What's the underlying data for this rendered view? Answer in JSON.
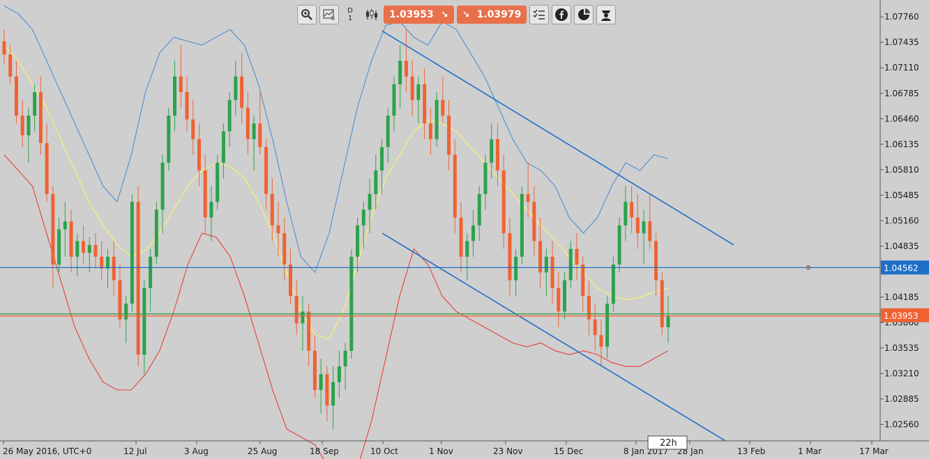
{
  "toolbar": {
    "timeframe_letter": "D",
    "timeframe_number": "1",
    "sell_price": "1.03953",
    "buy_price": "1.03979",
    "icons": [
      "zoom-icon",
      "chart-settings-icon",
      "candles-icon",
      "indicators-list-icon",
      "facebook-icon",
      "sentiment-icon",
      "trader-icon"
    ]
  },
  "chart_data": {
    "type": "candlestick",
    "instrument_timezone_label": "26 May 2016, UTC+0",
    "x_tick_labels": [
      "26 May 2016, UTC+0",
      "12 Jul",
      "3 Aug",
      "25 Aug",
      "18 Sep",
      "10 Oct",
      "1 Nov",
      "23 Nov",
      "15 Dec",
      "8 Jan 2017",
      "28 Jan",
      "13 Feb",
      "1 Mar",
      "17 Mar"
    ],
    "y_tick_labels": [
      "1.07760",
      "1.07435",
      "1.07110",
      "1.06785",
      "1.06460",
      "1.06135",
      "1.05810",
      "1.05485",
      "1.05160",
      "1.04835",
      "1.04185",
      "1.03860",
      "1.03535",
      "1.03210",
      "1.02885",
      "1.02560"
    ],
    "ylim": [
      1.0235,
      1.0794
    ],
    "horizontal_line_price": "1.04562",
    "current_price_label": "1.03953",
    "countdown_label": "22h",
    "candles_ohlc": [
      [
        1.0745,
        1.076,
        1.0715,
        1.0728
      ],
      [
        1.0728,
        1.074,
        1.069,
        1.07
      ],
      [
        1.07,
        1.072,
        1.064,
        1.065
      ],
      [
        1.065,
        1.067,
        1.061,
        1.0625
      ],
      [
        1.0625,
        1.066,
        1.059,
        1.065
      ],
      [
        1.065,
        1.069,
        1.063,
        1.068
      ],
      [
        1.068,
        1.07,
        1.06,
        1.0615
      ],
      [
        1.0615,
        1.064,
        1.054,
        1.055
      ],
      [
        1.055,
        1.056,
        1.043,
        1.046
      ],
      [
        1.046,
        1.052,
        1.045,
        1.0505
      ],
      [
        1.0505,
        1.054,
        1.047,
        1.0515
      ],
      [
        1.0515,
        1.053,
        1.045,
        1.047
      ],
      [
        1.047,
        1.05,
        1.0445,
        1.049
      ],
      [
        1.049,
        1.051,
        1.046,
        1.0475
      ],
      [
        1.0475,
        1.0495,
        1.045,
        1.0485
      ],
      [
        1.0485,
        1.05,
        1.0455,
        1.047
      ],
      [
        1.047,
        1.049,
        1.044,
        1.0455
      ],
      [
        1.0455,
        1.048,
        1.043,
        1.047
      ],
      [
        1.047,
        1.049,
        1.042,
        1.044
      ],
      [
        1.044,
        1.046,
        1.038,
        1.039
      ],
      [
        1.039,
        1.042,
        1.036,
        1.041
      ],
      [
        1.041,
        1.055,
        1.04,
        1.054
      ],
      [
        1.054,
        1.056,
        1.033,
        1.0345
      ],
      [
        1.0345,
        1.044,
        1.032,
        1.043
      ],
      [
        1.043,
        1.048,
        1.04,
        1.047
      ],
      [
        1.047,
        1.054,
        1.046,
        1.053
      ],
      [
        1.053,
        1.06,
        1.05,
        1.059
      ],
      [
        1.059,
        1.066,
        1.058,
        1.065
      ],
      [
        1.065,
        1.072,
        1.063,
        1.07
      ],
      [
        1.07,
        1.074,
        1.066,
        1.068
      ],
      [
        1.068,
        1.07,
        1.063,
        1.0645
      ],
      [
        1.0645,
        1.067,
        1.06,
        1.062
      ],
      [
        1.062,
        1.064,
        1.056,
        1.058
      ],
      [
        1.058,
        1.06,
        1.05,
        1.052
      ],
      [
        1.052,
        1.056,
        1.049,
        1.054
      ],
      [
        1.054,
        1.06,
        1.053,
        1.059
      ],
      [
        1.059,
        1.064,
        1.057,
        1.063
      ],
      [
        1.063,
        1.068,
        1.061,
        1.067
      ],
      [
        1.067,
        1.072,
        1.065,
        1.07
      ],
      [
        1.07,
        1.073,
        1.064,
        1.066
      ],
      [
        1.066,
        1.068,
        1.06,
        1.062
      ],
      [
        1.062,
        1.065,
        1.058,
        1.064
      ],
      [
        1.064,
        1.068,
        1.06,
        1.061
      ],
      [
        1.061,
        1.062,
        1.053,
        1.055
      ],
      [
        1.055,
        1.057,
        1.049,
        1.051
      ],
      [
        1.051,
        1.054,
        1.047,
        1.05
      ],
      [
        1.05,
        1.052,
        1.044,
        1.046
      ],
      [
        1.046,
        1.048,
        1.041,
        1.042
      ],
      [
        1.042,
        1.044,
        1.037,
        1.0385
      ],
      [
        1.0385,
        1.042,
        1.035,
        1.04
      ],
      [
        1.04,
        1.041,
        1.033,
        1.035
      ],
      [
        1.035,
        1.037,
        1.029,
        1.03
      ],
      [
        1.03,
        1.034,
        1.027,
        1.032
      ],
      [
        1.032,
        1.033,
        1.026,
        1.028
      ],
      [
        1.028,
        1.033,
        1.025,
        1.031
      ],
      [
        1.031,
        1.035,
        1.029,
        1.033
      ],
      [
        1.033,
        1.036,
        1.03,
        1.035
      ],
      [
        1.035,
        1.048,
        1.034,
        1.047
      ],
      [
        1.047,
        1.052,
        1.045,
        1.051
      ],
      [
        1.051,
        1.054,
        1.048,
        1.053
      ],
      [
        1.053,
        1.057,
        1.05,
        1.055
      ],
      [
        1.055,
        1.06,
        1.053,
        1.058
      ],
      [
        1.058,
        1.062,
        1.055,
        1.061
      ],
      [
        1.061,
        1.066,
        1.059,
        1.065
      ],
      [
        1.065,
        1.07,
        1.063,
        1.069
      ],
      [
        1.069,
        1.074,
        1.066,
        1.072
      ],
      [
        1.072,
        1.076,
        1.068,
        1.07
      ],
      [
        1.07,
        1.072,
        1.065,
        1.067
      ],
      [
        1.067,
        1.07,
        1.064,
        1.069
      ],
      [
        1.069,
        1.071,
        1.062,
        1.064
      ],
      [
        1.064,
        1.066,
        1.06,
        1.062
      ],
      [
        1.062,
        1.068,
        1.061,
        1.067
      ],
      [
        1.067,
        1.07,
        1.064,
        1.065
      ],
      [
        1.065,
        1.067,
        1.058,
        1.06
      ],
      [
        1.06,
        1.062,
        1.05,
        1.052
      ],
      [
        1.052,
        1.054,
        1.045,
        1.047
      ],
      [
        1.047,
        1.05,
        1.044,
        1.049
      ],
      [
        1.049,
        1.053,
        1.047,
        1.051
      ],
      [
        1.051,
        1.056,
        1.049,
        1.055
      ],
      [
        1.055,
        1.06,
        1.053,
        1.059
      ],
      [
        1.059,
        1.064,
        1.057,
        1.062
      ],
      [
        1.062,
        1.064,
        1.056,
        1.058
      ],
      [
        1.058,
        1.06,
        1.048,
        1.05
      ],
      [
        1.05,
        1.052,
        1.042,
        1.044
      ],
      [
        1.044,
        1.048,
        1.042,
        1.047
      ],
      [
        1.047,
        1.056,
        1.046,
        1.055
      ],
      [
        1.055,
        1.059,
        1.052,
        1.054
      ],
      [
        1.054,
        1.056,
        1.047,
        1.049
      ],
      [
        1.049,
        1.052,
        1.043,
        1.045
      ],
      [
        1.045,
        1.048,
        1.042,
        1.047
      ],
      [
        1.047,
        1.049,
        1.041,
        1.043
      ],
      [
        1.043,
        1.045,
        1.038,
        1.04
      ],
      [
        1.04,
        1.045,
        1.039,
        1.044
      ],
      [
        1.044,
        1.049,
        1.043,
        1.048
      ],
      [
        1.048,
        1.05,
        1.044,
        1.046
      ],
      [
        1.046,
        1.047,
        1.04,
        1.042
      ],
      [
        1.042,
        1.044,
        1.037,
        1.039
      ],
      [
        1.039,
        1.041,
        1.035,
        1.037
      ],
      [
        1.037,
        1.039,
        1.033,
        1.0355
      ],
      [
        1.0355,
        1.042,
        1.034,
        1.041
      ],
      [
        1.041,
        1.047,
        1.04,
        1.046
      ],
      [
        1.046,
        1.052,
        1.045,
        1.051
      ],
      [
        1.051,
        1.056,
        1.049,
        1.054
      ],
      [
        1.054,
        1.056,
        1.05,
        1.052
      ],
      [
        1.052,
        1.055,
        1.048,
        1.05
      ],
      [
        1.05,
        1.053,
        1.046,
        1.0515
      ],
      [
        1.0515,
        1.055,
        1.048,
        1.049
      ],
      [
        1.049,
        1.05,
        1.042,
        1.044
      ],
      [
        1.044,
        1.045,
        1.037,
        1.038
      ],
      [
        1.038,
        1.042,
        1.036,
        1.0395
      ]
    ],
    "yellow_middle_band": [
      1.074,
      1.072,
      1.069,
      1.066,
      1.062,
      1.058,
      1.054,
      1.051,
      1.0485,
      1.047,
      1.0478,
      1.05,
      1.053,
      1.056,
      1.058,
      1.059,
      1.0585,
      1.057,
      1.054,
      1.05,
      1.045,
      1.04,
      1.037,
      1.0365,
      1.04,
      1.046,
      1.052,
      1.057,
      1.06,
      1.063,
      1.0645,
      1.064,
      1.063,
      1.061,
      1.059,
      1.057,
      1.055,
      1.053,
      1.051,
      1.049,
      1.047,
      1.045,
      1.043,
      1.042,
      1.0415,
      1.0418,
      1.0425,
      1.043
    ],
    "blue_upper_band": [
      1.079,
      1.078,
      1.076,
      1.072,
      1.068,
      1.064,
      1.06,
      1.056,
      1.054,
      1.06,
      1.068,
      1.073,
      1.075,
      1.0745,
      1.074,
      1.075,
      1.076,
      1.074,
      1.069,
      1.062,
      1.054,
      1.047,
      1.045,
      1.05,
      1.058,
      1.066,
      1.072,
      1.0765,
      1.077,
      1.075,
      1.074,
      1.077,
      1.076,
      1.073,
      1.07,
      1.066,
      1.062,
      1.059,
      1.058,
      1.056,
      1.052,
      1.05,
      1.052,
      1.056,
      1.059,
      1.058,
      1.06,
      1.0595
    ],
    "red_lower_band": [
      1.06,
      1.058,
      1.056,
      1.05,
      1.044,
      1.038,
      1.034,
      1.031,
      1.03,
      1.03,
      1.032,
      1.035,
      1.04,
      1.046,
      1.05,
      1.0495,
      1.047,
      1.042,
      1.036,
      1.03,
      1.025,
      1.024,
      1.023,
      1.02,
      1.019,
      1.02,
      1.026,
      1.034,
      1.042,
      1.048,
      1.046,
      1.042,
      1.04,
      1.039,
      1.038,
      1.037,
      1.036,
      1.0355,
      1.036,
      1.035,
      1.0345,
      1.035,
      1.0345,
      1.0335,
      1.033,
      1.033,
      1.034,
      1.035
    ],
    "colors": {
      "background": "#cfcfcf",
      "bull_candle": "#2ca24b",
      "bear_candle": "#f06233",
      "upper_band": "#4e8fd0",
      "lower_band": "#e8403a",
      "middle_band": "#f5f07a",
      "trendline": "#1f6fc9",
      "hline": "#1f6fc9",
      "bid_line": "#2ca24b",
      "ask_line": "#f06233"
    }
  }
}
